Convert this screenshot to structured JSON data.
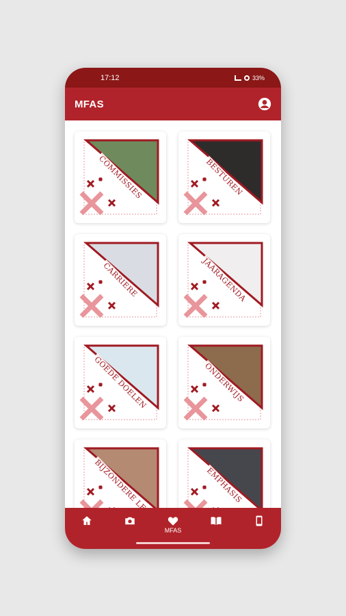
{
  "status_bar": {
    "time": "17:12",
    "battery": "33%"
  },
  "app_bar": {
    "title": "MFAS",
    "account_icon": "account-circle-icon"
  },
  "colors": {
    "primary": "#b1232a",
    "status_bar": "#8b1717",
    "accent": "#a01a22",
    "mark_light": "#e8959b"
  },
  "tiles": [
    {
      "label": "COMMISSIES",
      "photo_color": "#6f8a5c"
    },
    {
      "label": "BESTUREN",
      "photo_color": "#2e2b2b"
    },
    {
      "label": "CARRIERE",
      "photo_color": "#d9dde3"
    },
    {
      "label": "JAARAGENDA",
      "photo_color": "#f0eeee"
    },
    {
      "label": "GOEDE DOELEN",
      "photo_color": "#dbe7ee"
    },
    {
      "label": "ONDERWIJS",
      "photo_color": "#8c6c4d"
    },
    {
      "label": "BIJZONDERE LE",
      "photo_color": "#b58a72"
    },
    {
      "label": "EMPHASIS",
      "photo_color": "#46474c"
    }
  ],
  "bottom_nav": [
    {
      "label": "",
      "icon": "home-icon"
    },
    {
      "label": "",
      "icon": "camera-icon"
    },
    {
      "label": "MFAS",
      "icon": "heart-icon"
    },
    {
      "label": "",
      "icon": "book-icon"
    },
    {
      "label": "",
      "icon": "phone-icon"
    }
  ]
}
